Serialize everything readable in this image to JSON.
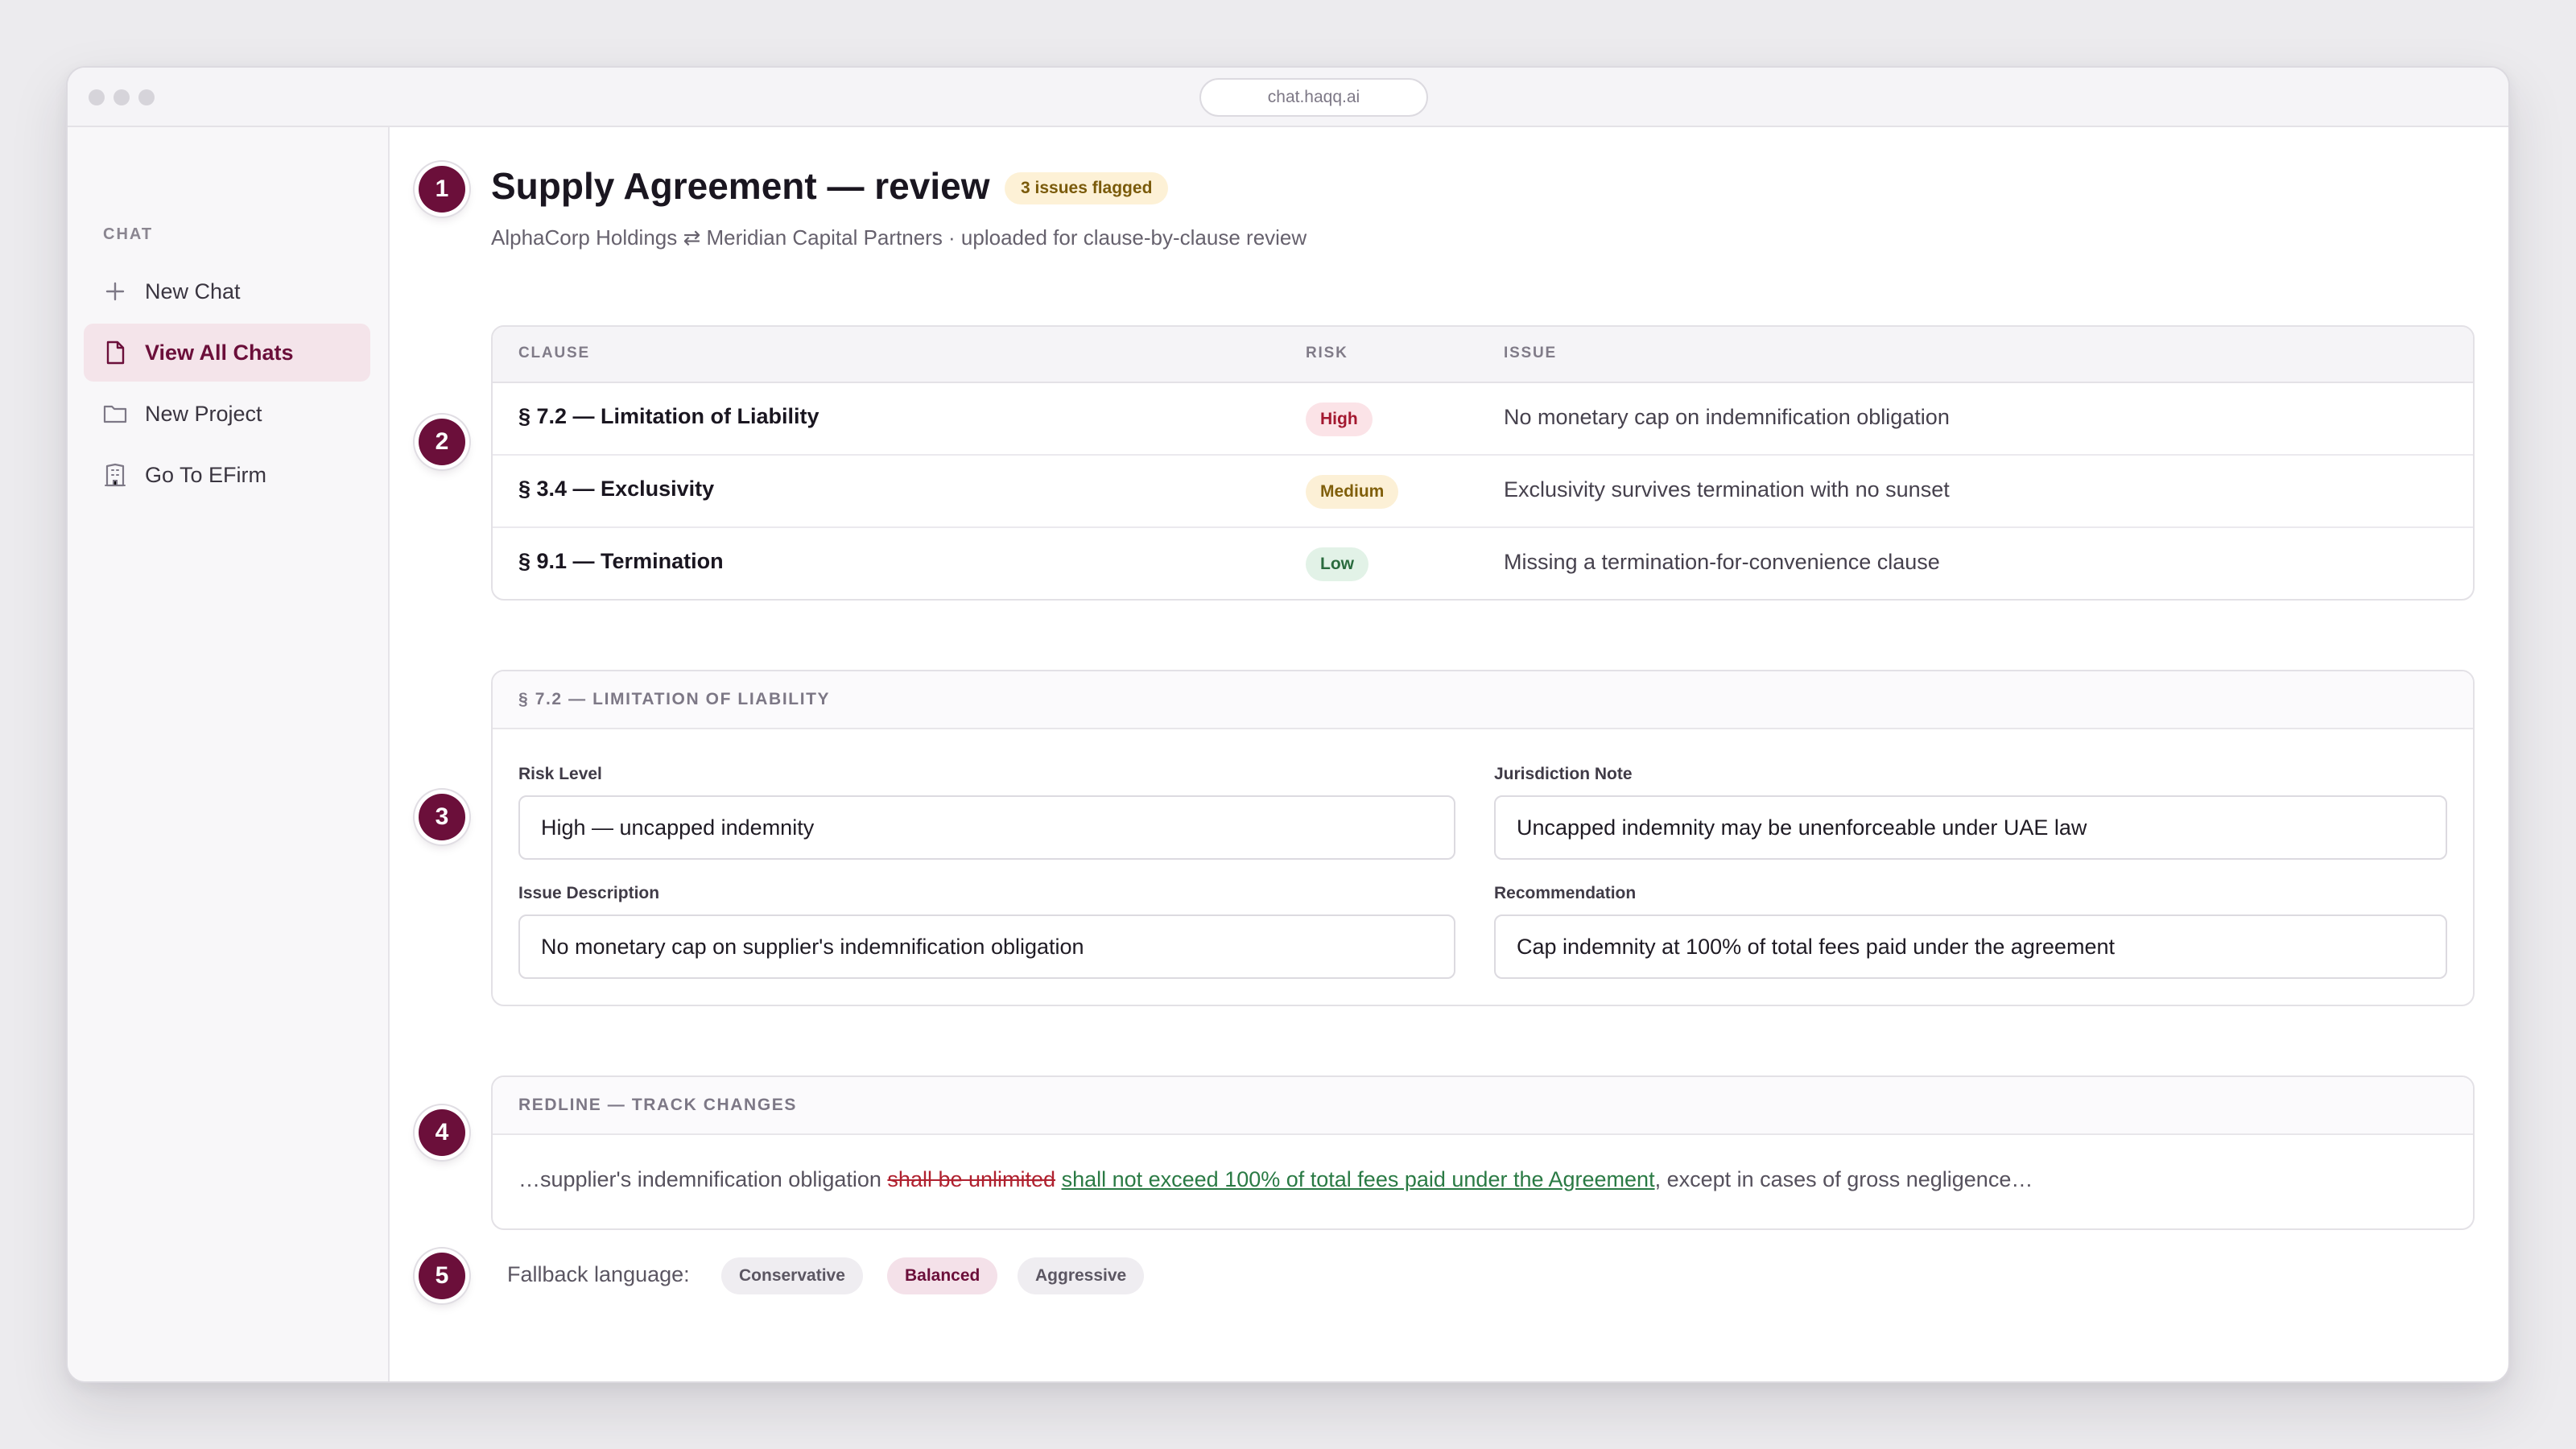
{
  "browser": {
    "url": "chat.haqq.ai"
  },
  "sidebar": {
    "section_label": "CHAT",
    "items": [
      {
        "label": "New Chat",
        "icon": "plus-icon",
        "active": false
      },
      {
        "label": "View All Chats",
        "icon": "document-icon",
        "active": true
      },
      {
        "label": "New Project",
        "icon": "folder-icon",
        "active": false
      },
      {
        "label": "Go To EFirm",
        "icon": "building-icon",
        "active": false
      }
    ]
  },
  "steps": [
    "1",
    "2",
    "3",
    "4",
    "5"
  ],
  "header": {
    "title": "Supply Agreement — review",
    "badge": "3 issues flagged",
    "subtitle": "AlphaCorp Holdings ⇄ Meridian Capital Partners · uploaded for clause-by-clause review"
  },
  "issues_table": {
    "columns": {
      "clause": "CLAUSE",
      "risk": "RISK",
      "issue": "ISSUE"
    },
    "rows": [
      {
        "clause": "§ 7.2 — Limitation of Liability",
        "risk": "High",
        "issue": "No monetary cap on indemnification obligation"
      },
      {
        "clause": "§ 3.4 — Exclusivity",
        "risk": "Medium",
        "issue": "Exclusivity survives termination with no sunset"
      },
      {
        "clause": "§ 9.1 — Termination",
        "risk": "Low",
        "issue": "Missing a termination-for-convenience clause"
      }
    ]
  },
  "detail": {
    "heading": "§ 7.2 — LIMITATION OF LIABILITY",
    "fields": {
      "risk_level": {
        "label": "Risk Level",
        "value": "High — uncapped indemnity"
      },
      "jurisdiction_note": {
        "label": "Jurisdiction Note",
        "value": "Uncapped indemnity may be unenforceable under UAE law"
      },
      "issue_description": {
        "label": "Issue Description",
        "value": "No monetary cap on supplier's indemnification obligation"
      },
      "recommendation": {
        "label": "Recommendation",
        "value": "Cap indemnity at 100% of total fees paid under the agreement"
      }
    }
  },
  "redline": {
    "heading": "REDLINE — TRACK CHANGES",
    "prefix": "…supplier's indemnification obligation ",
    "deleted": "shall be unlimited",
    "inserted": "shall not exceed 100% of total fees paid under the Agreement",
    "suffix": ", except in cases of gross negligence…"
  },
  "fallback": {
    "label": "Fallback language:",
    "options": [
      {
        "label": "Conservative",
        "active": false
      },
      {
        "label": "Balanced",
        "active": true
      },
      {
        "label": "Aggressive",
        "active": false
      }
    ]
  },
  "colors": {
    "brand": "#6b0f3a",
    "risk_high": "#a3172f",
    "risk_medium": "#805f0b",
    "risk_low": "#2a6b3e",
    "deleted_text": "#b0212f",
    "inserted_text": "#2a7a44"
  }
}
